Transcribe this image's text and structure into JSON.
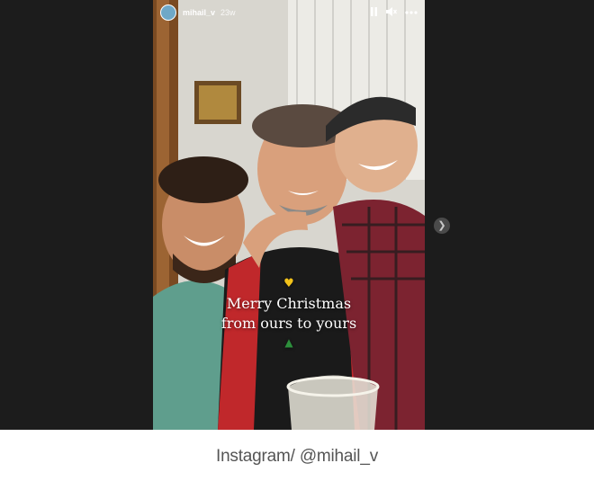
{
  "story": {
    "username": "mihail_v",
    "time": "23w",
    "caption_line1": "Merry Christmas",
    "caption_line2": "from ours to yours",
    "caption_heart_icon": "yellow-heart",
    "caption_tree_icon": "christmas-tree"
  },
  "controls": {
    "pause_icon": "pause-icon",
    "mute_icon": "speaker-icon",
    "more_icon": "more-icon"
  },
  "navigation": {
    "next_icon": "chevron-right-icon"
  },
  "credit": "Instagram/ @mihail_v",
  "colors": {
    "background_dark": "#1c1c1c",
    "credit_text": "#555555",
    "accent_yellow": "#f2c21a"
  }
}
